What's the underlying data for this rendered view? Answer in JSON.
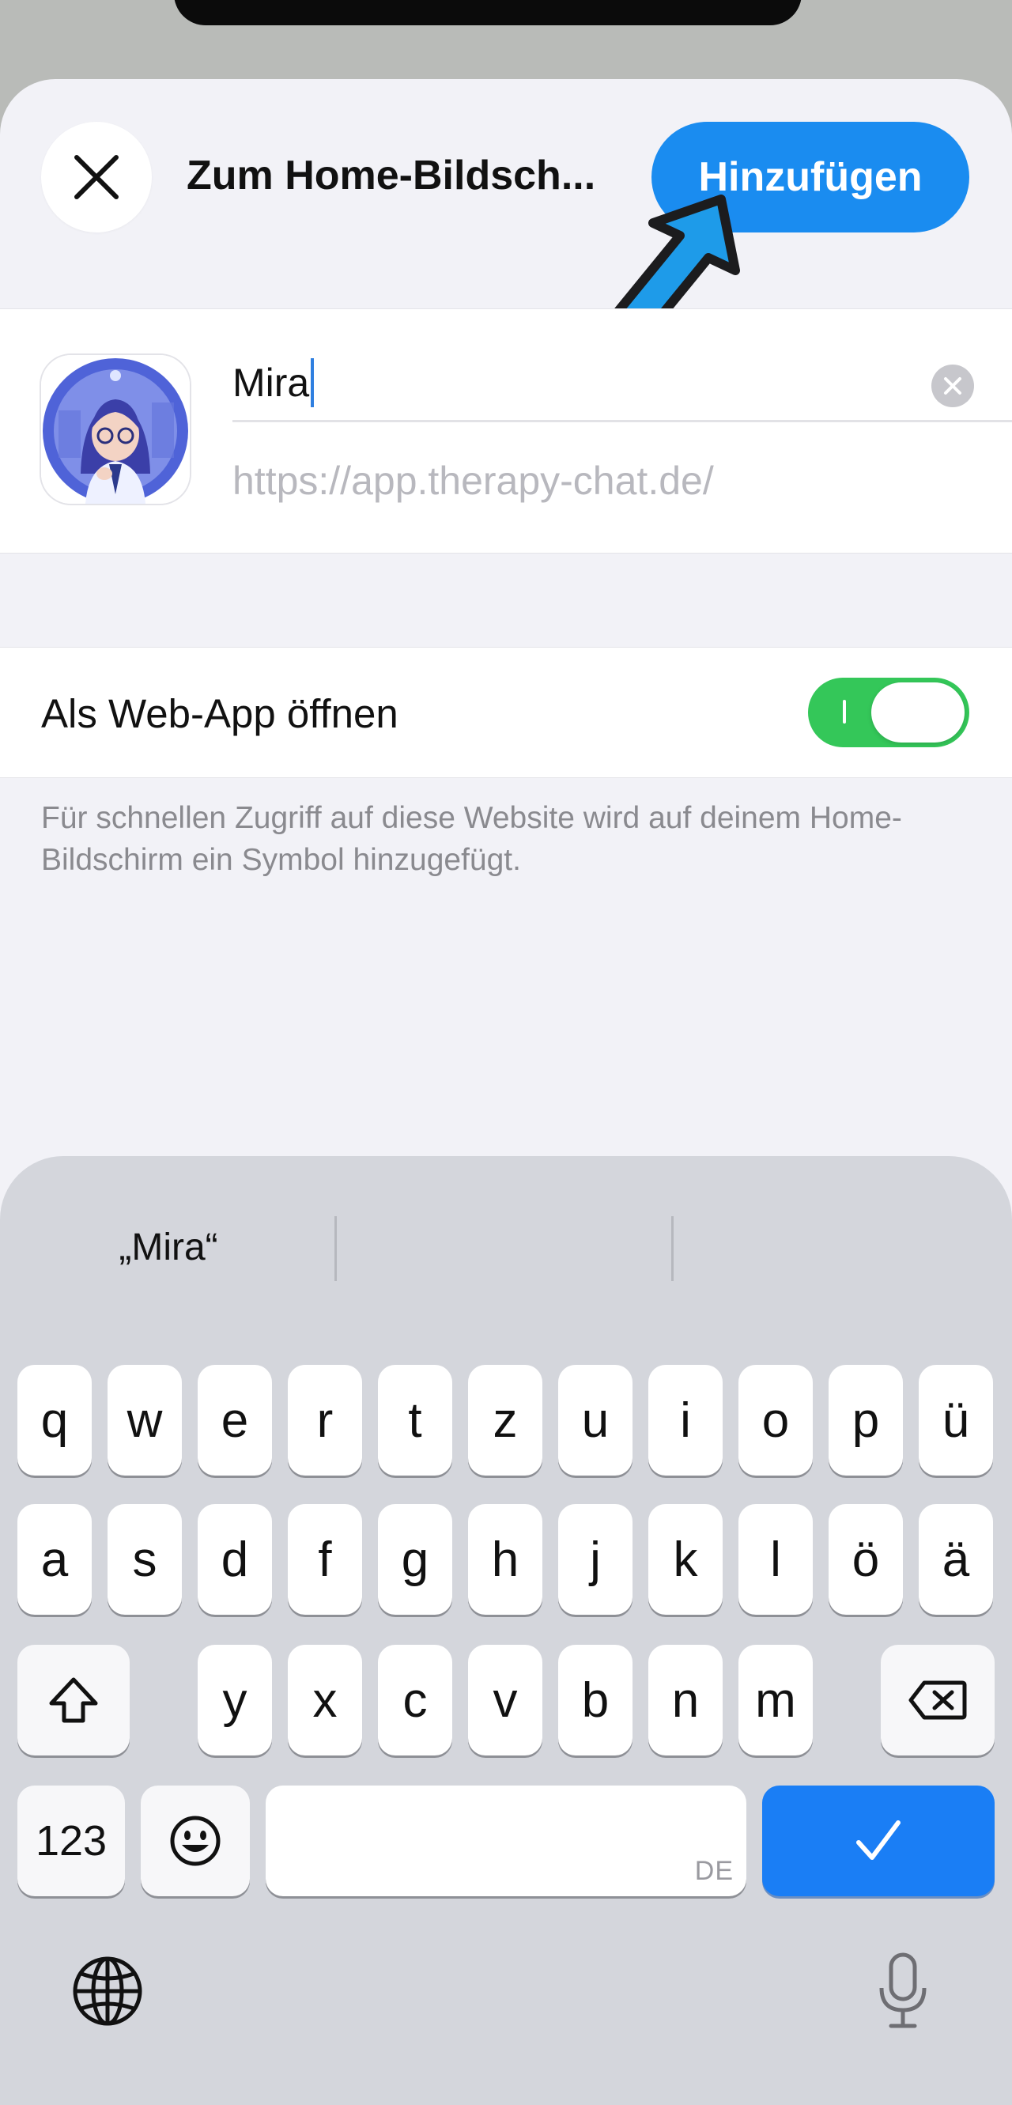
{
  "header": {
    "title": "Zum Home-Bildsch...",
    "add_label": "Hinzufügen"
  },
  "app": {
    "name_value": "Mira",
    "url": "https://app.therapy-chat.de/"
  },
  "settings": {
    "web_app_label": "Als Web-App öffnen",
    "web_app_enabled": true,
    "toggle_mark": "I",
    "description": "Für schnellen Zugriff auf diese Website wird auf deinem Home-Bildschirm ein Symbol hinzugefügt."
  },
  "colors": {
    "accent": "#1a8cf0",
    "toggle_on": "#34c759",
    "pointer_arrow": "#1e9be9"
  },
  "keyboard": {
    "suggestions": [
      "„Mira“",
      "",
      ""
    ],
    "row1": [
      "q",
      "w",
      "e",
      "r",
      "t",
      "z",
      "u",
      "i",
      "o",
      "p",
      "ü"
    ],
    "row2": [
      "a",
      "s",
      "d",
      "f",
      "g",
      "h",
      "j",
      "k",
      "l",
      "ö",
      "ä"
    ],
    "row3": [
      "y",
      "x",
      "c",
      "v",
      "b",
      "n",
      "m"
    ],
    "numbers_label": "123",
    "space_hint": "DE",
    "icons": {
      "shift": "shift-icon",
      "delete": "delete-icon",
      "emoji": "emoji-icon",
      "return": "checkmark-icon",
      "globe": "globe-icon",
      "mic": "microphone-icon"
    }
  }
}
